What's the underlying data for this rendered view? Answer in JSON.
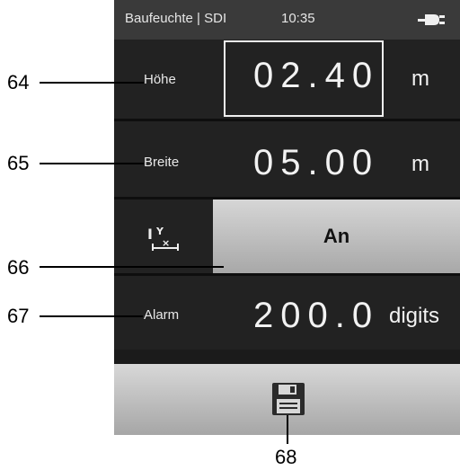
{
  "statusbar": {
    "title": "Baufeuchte | SDI",
    "time": "10:35",
    "icon": "plug-icon"
  },
  "rows": {
    "hoehe": {
      "label": "Höhe",
      "value": "02.40",
      "unit": "m"
    },
    "breite": {
      "label": "Breite",
      "value": "05.00",
      "unit": "m"
    },
    "toggle": {
      "label": "An",
      "icon": "dimension-toggle-icon"
    },
    "alarm": {
      "label": "Alarm",
      "value": "200.0",
      "unit": "digits"
    }
  },
  "save": {
    "icon": "floppy-disk-icon"
  },
  "callouts": [
    "64",
    "65",
    "66",
    "67",
    "68"
  ]
}
